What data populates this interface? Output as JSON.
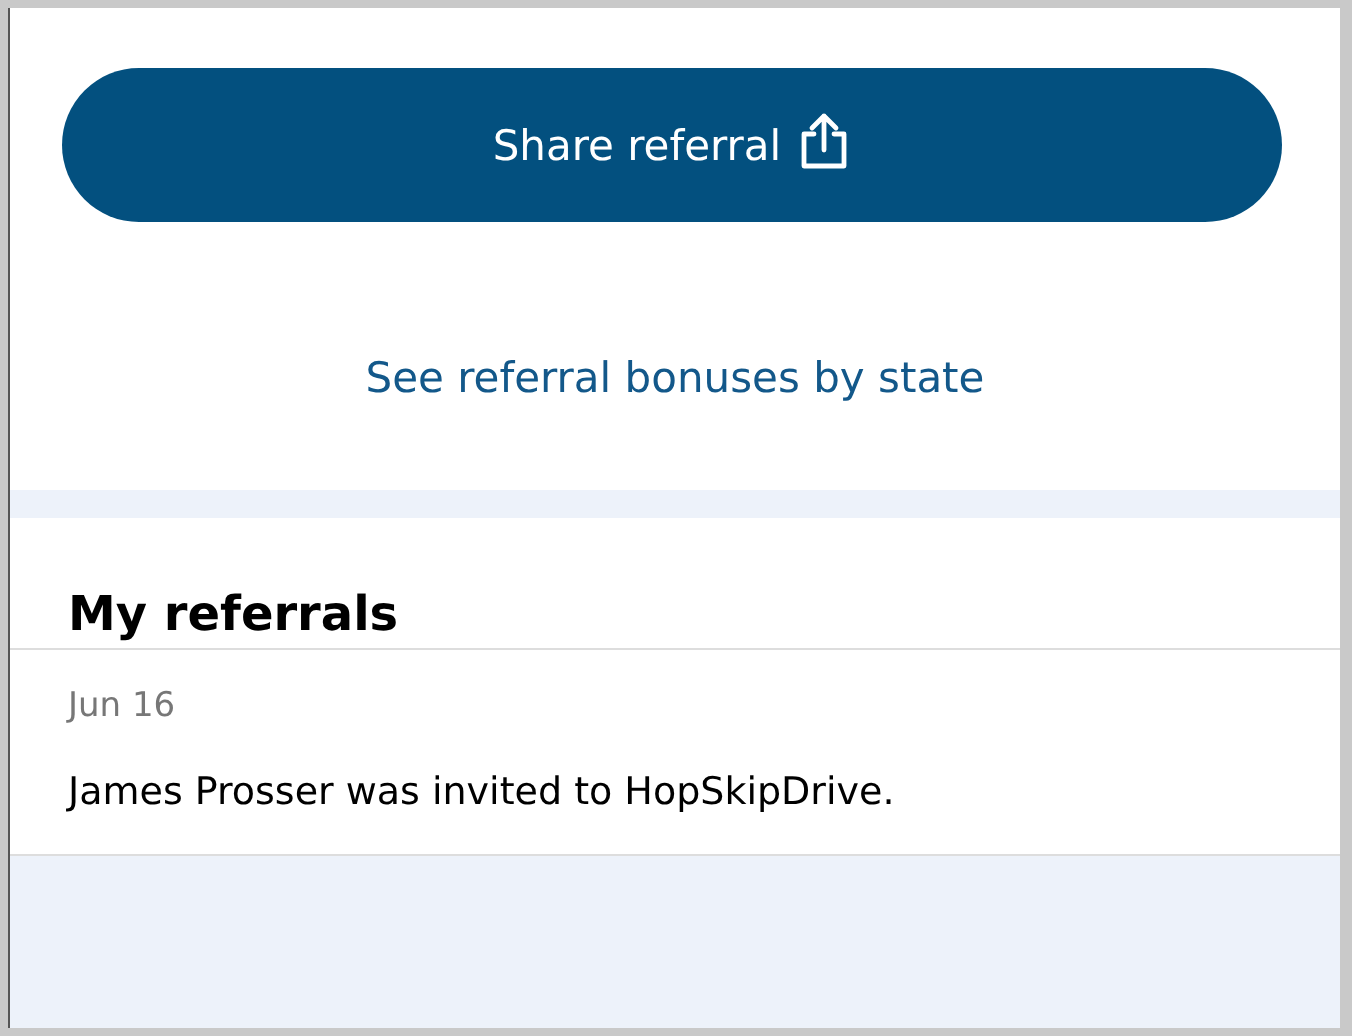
{
  "share_button": {
    "label": "Share referral"
  },
  "state_link": {
    "label": "See referral bonuses by state"
  },
  "referrals": {
    "title": "My referrals",
    "items": [
      {
        "date": "Jun 16",
        "text": "James Prosser was invited to HopSkipDrive."
      }
    ]
  }
}
